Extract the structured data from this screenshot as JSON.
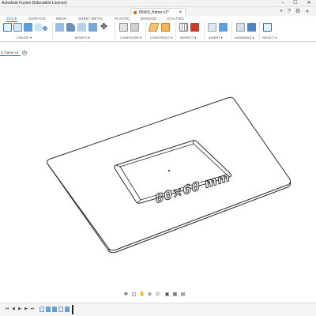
{
  "window": {
    "title": "Autodesk Fusion (Education License)",
    "minimize": "–",
    "maximize": "☐",
    "close": "✕"
  },
  "doc_tab": {
    "label": "80x60_frame v1*",
    "close": "✕"
  },
  "tabbar_right": {
    "add": "+",
    "help": "?",
    "notifications": "⚙",
    "account": "●"
  },
  "ribbon": {
    "tabs": [
      "SOLID",
      "SURFACE",
      "MESH",
      "SHEET METAL",
      "PLASTIC",
      "MANAGE",
      "UTILITIES"
    ],
    "active_tab": "SOLID",
    "groups": [
      "CREATE ▾",
      "MODIFY ▾",
      "CONFIGURE ▾",
      "CONSTRUCT ▾",
      "INSPECT ▾",
      "INSERT ▾",
      "ASSEMBLE ▾",
      "SELECT ▾"
    ]
  },
  "browser": {
    "tab_label": "0_frame v1",
    "add": "+"
  },
  "model": {
    "engraved_text": "80×60 mm"
  },
  "colors": {
    "accent": "#1a6fc4",
    "fusion_orange": "#e06b1f"
  }
}
